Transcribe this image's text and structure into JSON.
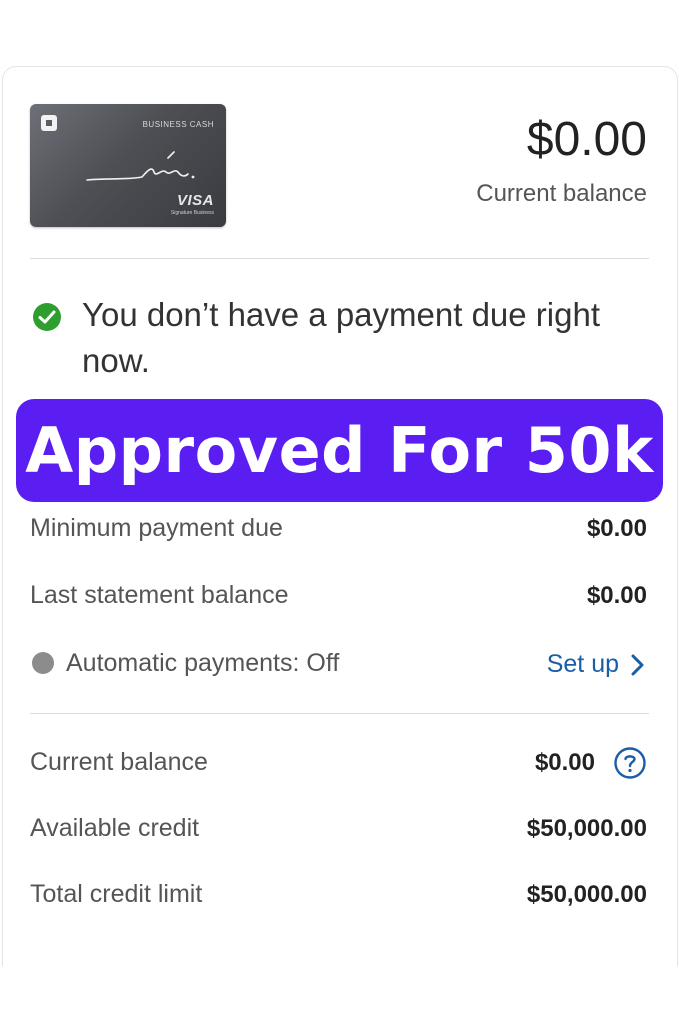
{
  "card": {
    "product": "BUSINESS CASH",
    "script": "ink.",
    "network": "VISA",
    "network_sub": "Signature Business"
  },
  "summary": {
    "balance_amount": "$0.00",
    "balance_label": "Current balance"
  },
  "status": {
    "message": "You don’t have a payment due right now."
  },
  "banner": {
    "text": "Approved For 50k",
    "color": "#5b1ef2"
  },
  "payment_rows": [
    {
      "label": "Minimum payment due",
      "value": "$0.00"
    },
    {
      "label": "Last statement balance",
      "value": "$0.00"
    }
  ],
  "autopay": {
    "label": "Automatic payments: Off",
    "link": "Set up"
  },
  "credit_rows": [
    {
      "label": "Current balance",
      "value": "$0.00"
    },
    {
      "label": "Available credit",
      "value": "$50,000.00"
    },
    {
      "label": "Total credit limit",
      "value": "$50,000.00"
    }
  ],
  "colors": {
    "accent": "#5b1ef2",
    "link": "#1a5ea8",
    "success": "#2e9e2e"
  },
  "icons": [
    "check-circle-icon",
    "status-dot-icon",
    "chevron-right-icon",
    "help-circle-icon",
    "bank-logo-icon"
  ]
}
